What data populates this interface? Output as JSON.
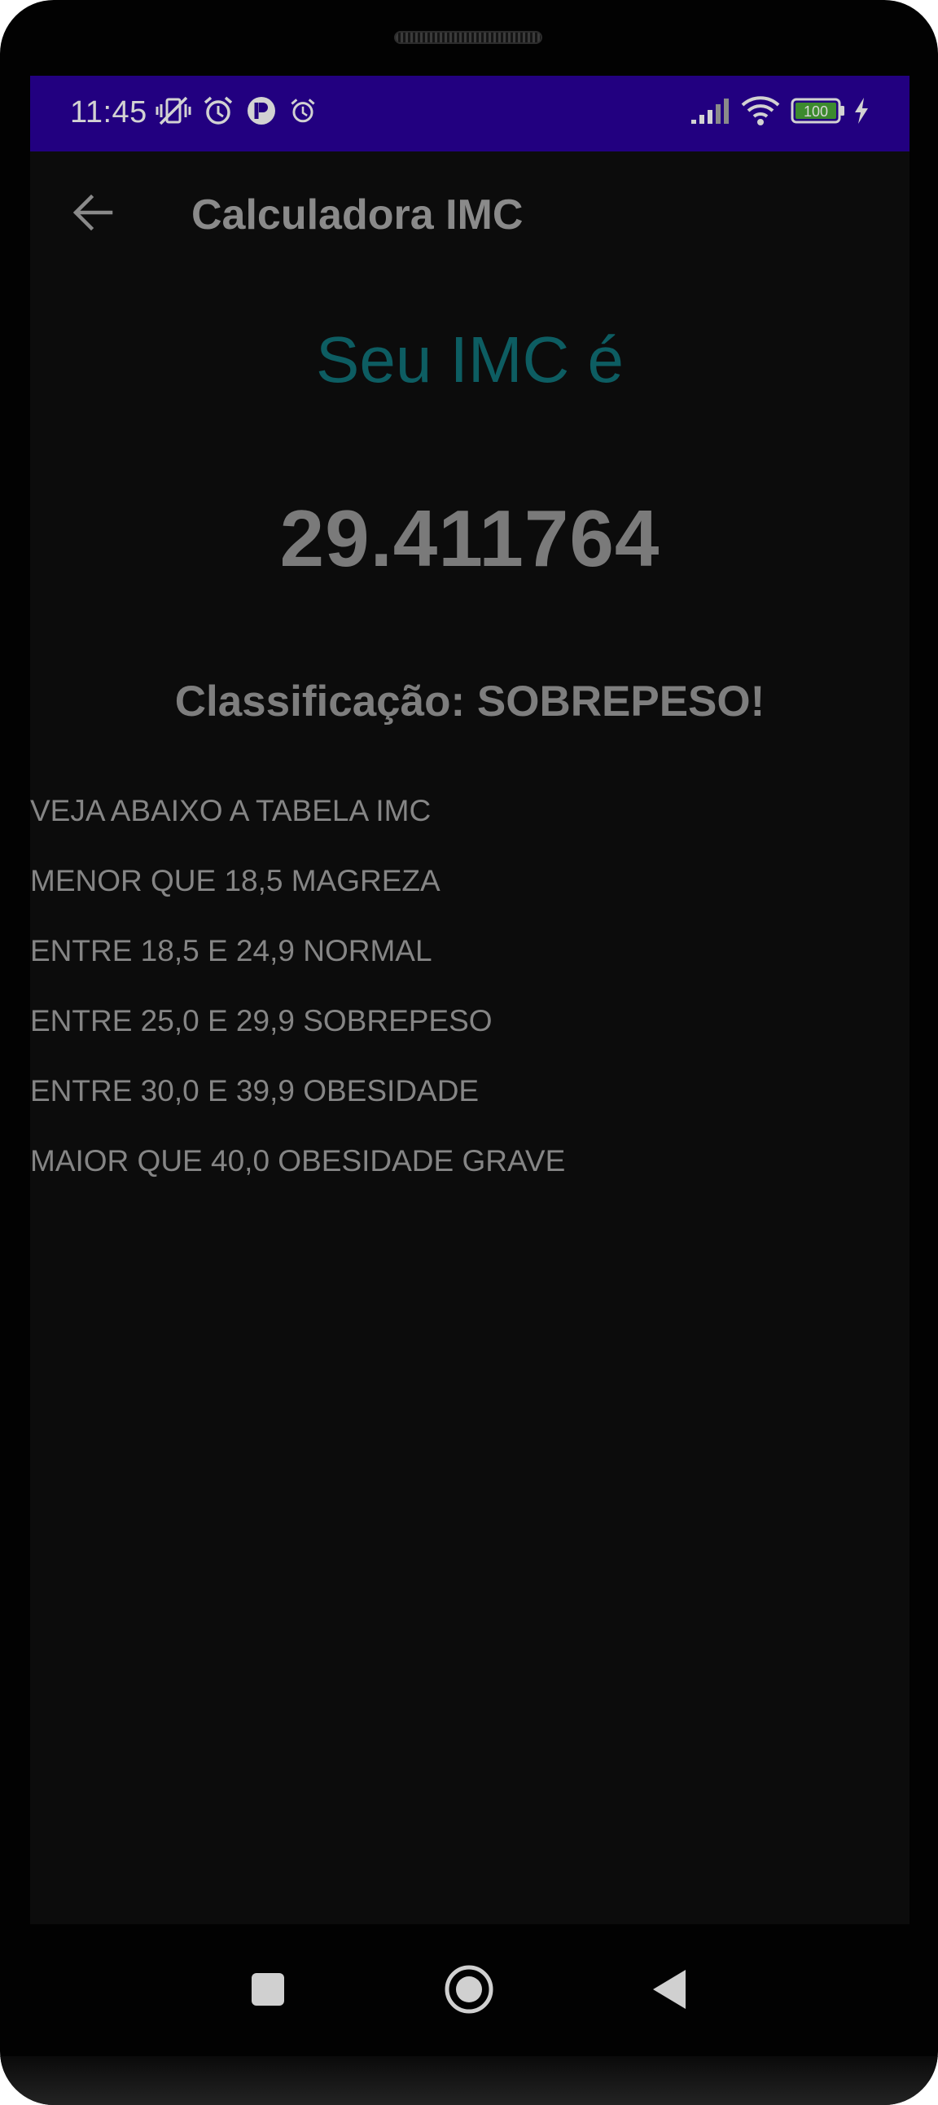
{
  "status_bar": {
    "time": "11:45",
    "battery": "100",
    "icons": [
      "vibrate-off-icon",
      "alarm-icon",
      "app-notification-icon",
      "alarm-small-icon",
      "signal-icon",
      "wifi-icon",
      "battery-icon",
      "charging-icon"
    ]
  },
  "app_bar": {
    "back_icon": "arrow-left-icon",
    "title": "Calculadora IMC"
  },
  "result": {
    "heading": "Seu IMC é",
    "value": "29.411764",
    "classification": "Classificação: SOBREPESO!"
  },
  "imc_table": {
    "items": [
      "VEJA ABAIXO A TABELA IMC",
      "MENOR QUE 18,5 MAGREZA",
      "ENTRE 18,5 E 24,9 NORMAL",
      "ENTRE 25,0 E 29,9 SOBREPESO",
      "ENTRE 30,0 E 39,9 OBESIDADE",
      "MAIOR QUE 40,0 OBESIDADE GRAVE"
    ]
  },
  "nav_bar": {
    "icons": [
      "recents-square-icon",
      "home-circle-icon",
      "back-triangle-icon"
    ]
  },
  "colors": {
    "status_bar": "#220080",
    "screen_background": "#0c0c0c",
    "heading": "#0d5d62",
    "battery_fill": "#3c8a2e"
  }
}
